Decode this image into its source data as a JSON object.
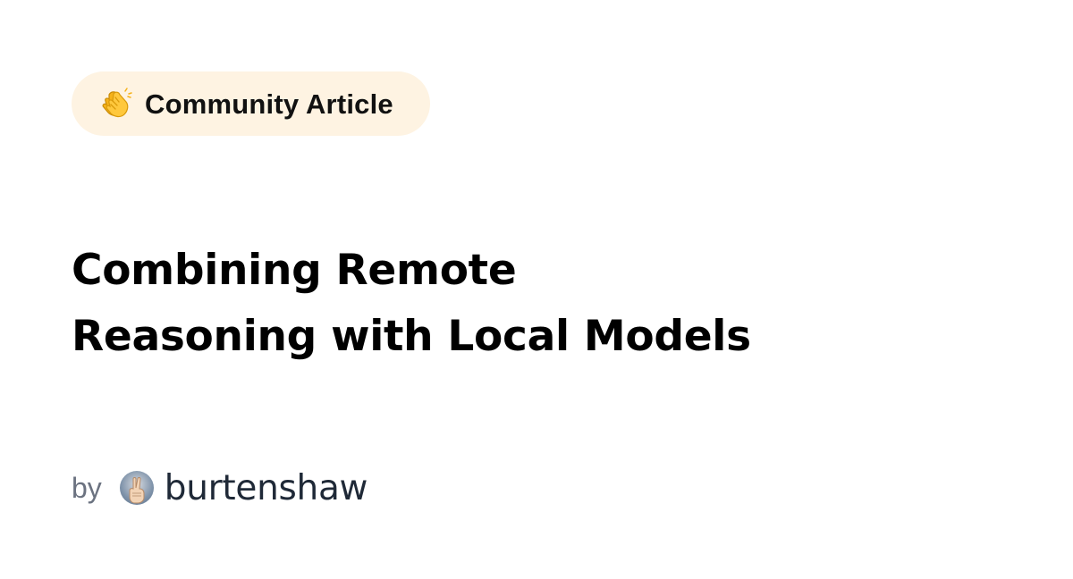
{
  "badge": {
    "icon": "clapping-hands-icon",
    "label": "Community Article",
    "background_color": "#fef3e2"
  },
  "article": {
    "title_lines": [
      "Combining Remote",
      "Reasoning with Local Models"
    ]
  },
  "byline": {
    "prefix": "by",
    "avatar_icon": "peace-hand-avatar",
    "author": "burtenshaw"
  }
}
